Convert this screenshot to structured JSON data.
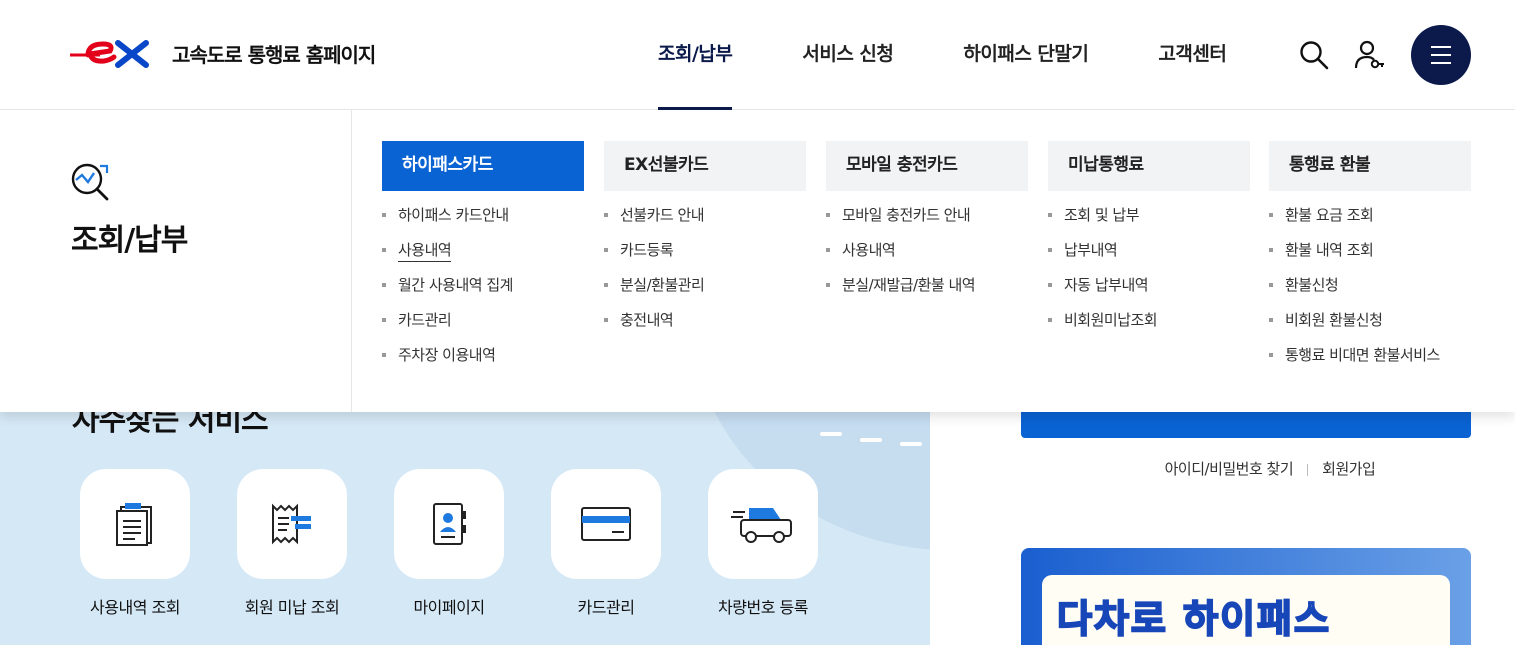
{
  "header": {
    "logo_text": "고속도로 통행료 홈페이지",
    "nav": [
      "조회/납부",
      "서비스 신청",
      "하이패스 단말기",
      "고객센터"
    ],
    "active_nav": "조회/납부",
    "icons": [
      "search-icon",
      "user-key-icon",
      "hamburger-menu-icon"
    ]
  },
  "mega_menu": {
    "title": "조회/납부",
    "columns": [
      {
        "title": "하이패스카드",
        "active": true,
        "items": [
          "하이패스 카드안내",
          "사용내역",
          "월간 사용내역 집계",
          "카드관리",
          "주차장 이용내역"
        ]
      },
      {
        "title": "EX선불카드",
        "items": [
          "선불카드 안내",
          "카드등록",
          "분실/환불관리",
          "충전내역"
        ]
      },
      {
        "title": "모바일 충전카드",
        "items": [
          "모바일 충전카드 안내",
          "사용내역",
          "분실/재발급/환불 내역"
        ]
      },
      {
        "title": "미납통행료",
        "items": [
          "조회 및 납부",
          "납부내역",
          "자동 납부내역",
          "비회원미납조회"
        ]
      },
      {
        "title": "통행료 환불",
        "items": [
          "환불 요금 조회",
          "환불 내역 조회",
          "환불신청",
          "비회원 환불신청",
          "통행료 비대면 환불서비스"
        ]
      }
    ]
  },
  "services": {
    "title": "자주찾는 서비스",
    "items": [
      {
        "label": "사용내역 조회",
        "icon": "document-list-icon"
      },
      {
        "label": "회원 미납 조회",
        "icon": "receipt-icon"
      },
      {
        "label": "마이페이지",
        "icon": "contact-book-icon"
      },
      {
        "label": "카드관리",
        "icon": "credit-card-icon"
      },
      {
        "label": "차량번호 등록",
        "icon": "car-icon"
      }
    ]
  },
  "login": {
    "links": [
      "아이디/비밀번호 찾기",
      "회원가입"
    ]
  },
  "banner": {
    "text": "다차로 하이패스"
  },
  "colors": {
    "navy": "#0b1a4a",
    "accent_blue": "#0a63d3",
    "logo_red": "#e2001a",
    "panel_bg": "#d5e8f6"
  }
}
